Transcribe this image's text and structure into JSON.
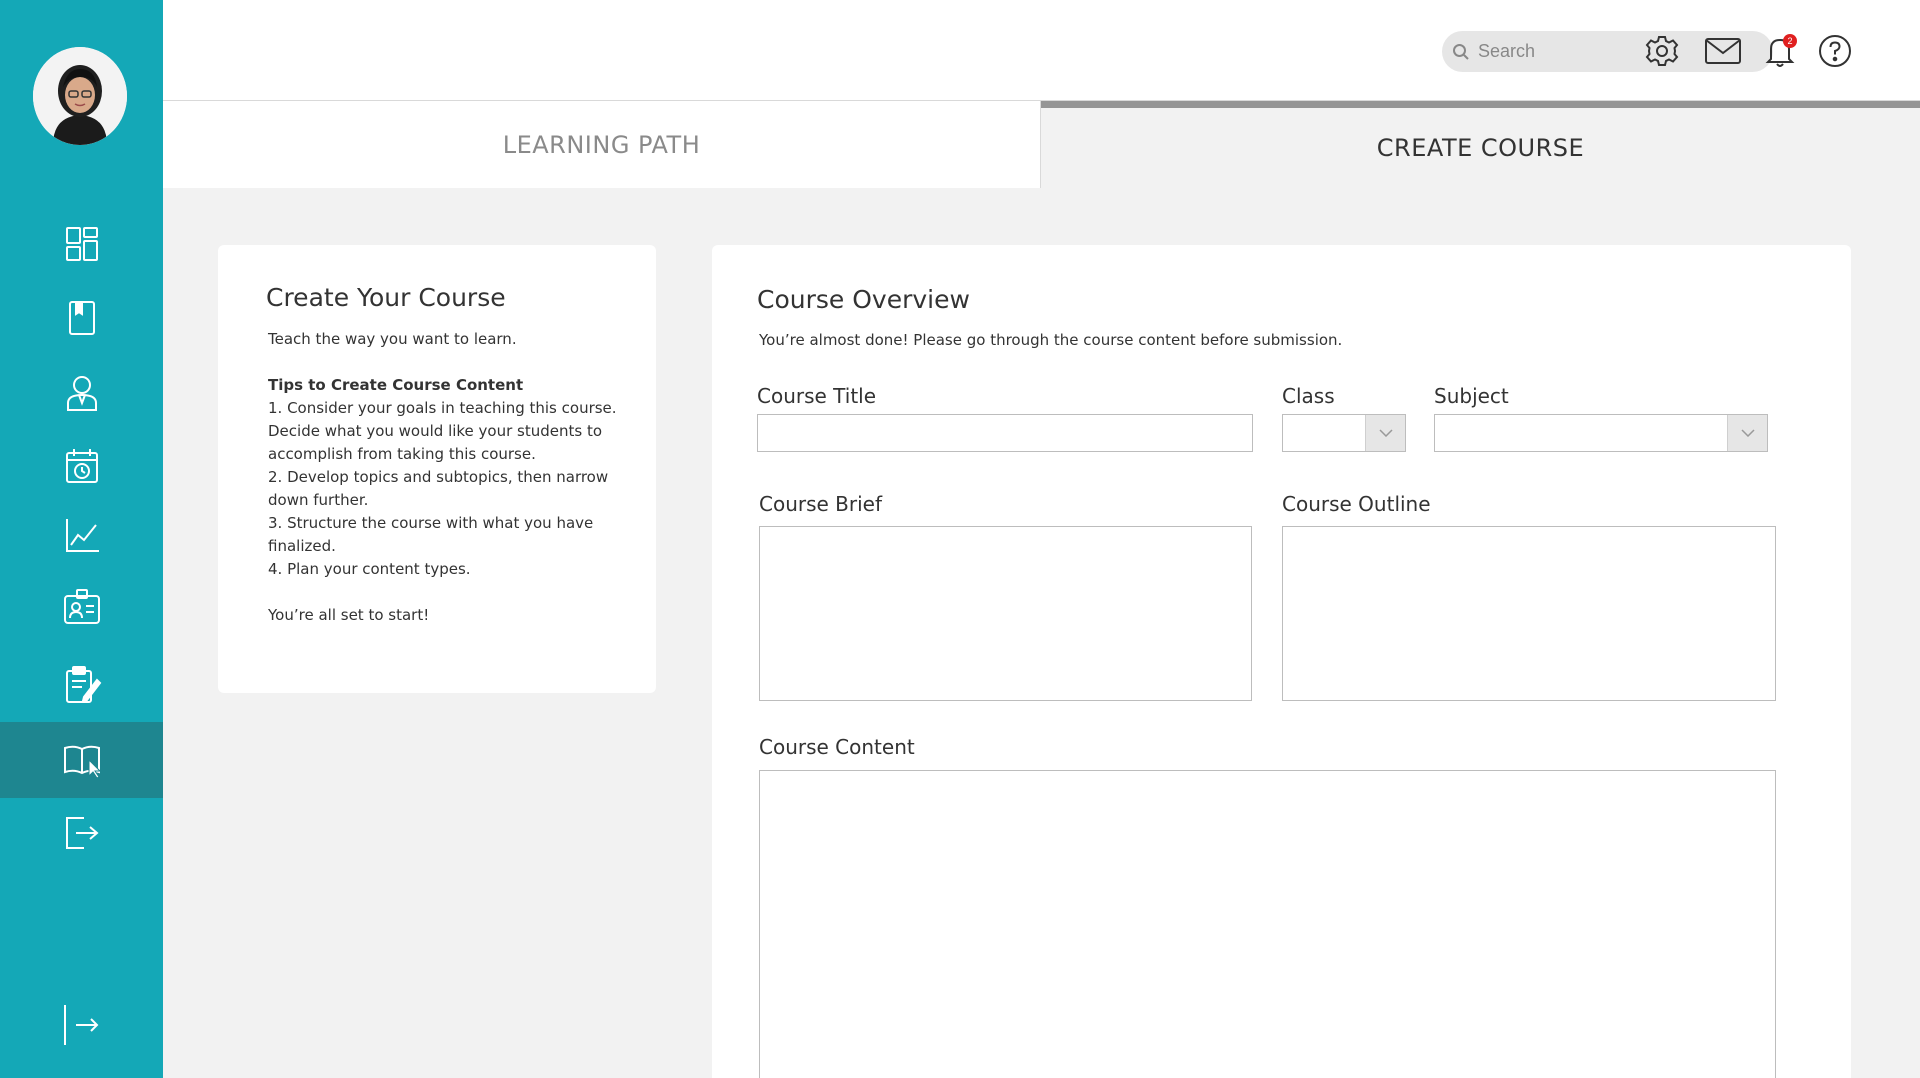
{
  "sidebar": {
    "items": [
      {
        "icon": "dashboard-icon"
      },
      {
        "icon": "book-icon"
      },
      {
        "icon": "user-icon"
      },
      {
        "icon": "calendar-icon"
      },
      {
        "icon": "chart-icon"
      },
      {
        "icon": "id-card-icon"
      },
      {
        "icon": "clipboard-edit-icon"
      },
      {
        "icon": "open-book-icon",
        "active": true
      },
      {
        "icon": "logout-icon"
      }
    ],
    "collapse_icon": "expand-arrow-icon",
    "accent_color": "#14a8b7",
    "active_color": "#1e8690"
  },
  "header": {
    "search_placeholder": "Search",
    "notification_count": "2"
  },
  "tabs": [
    {
      "label": "LEARNING PATH",
      "active": false
    },
    {
      "label": "CREATE COURSE",
      "active": true
    }
  ],
  "guide": {
    "title": "Create Your Course",
    "intro": "Teach the way you want to learn.",
    "tips_title": "Tips to Create Course Content",
    "tips": [
      "1. Consider your goals in teaching this course. Decide what you would like your students to accomplish from taking this course.",
      "2. Develop topics and subtopics, then narrow down further.",
      "3. Structure the course with what you have finalized.",
      "4. Plan your content types."
    ],
    "closing": "You’re all set to start!"
  },
  "form": {
    "title": "Course Overview",
    "subtitle": "You’re almost done! Please go through the course content before submission.",
    "course_title_label": "Course Title",
    "course_title_value": "",
    "class_label": "Class",
    "class_value": "",
    "subject_label": "Subject",
    "subject_value": "",
    "brief_label": "Course Brief",
    "outline_label": "Course Outline",
    "content_label": "Course Content"
  }
}
